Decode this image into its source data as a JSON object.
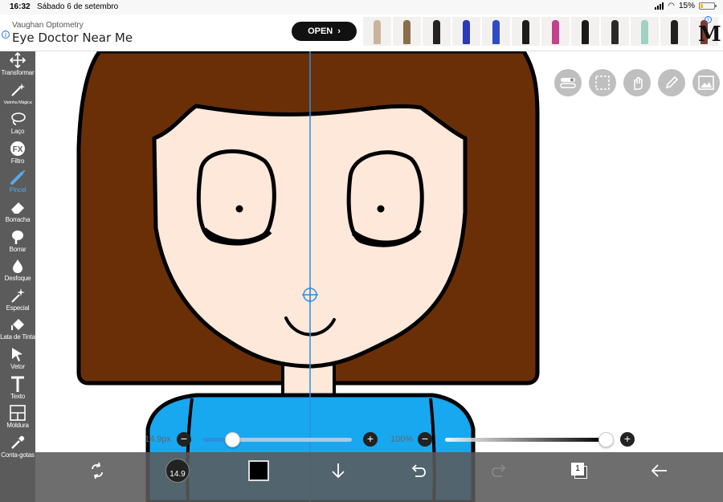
{
  "status_bar": {
    "time": "16:32",
    "date": "Sábado 6 de setembro",
    "battery": "15%",
    "battery_level": 0.15
  },
  "ad": {
    "brand": "Vaughan Optometry",
    "title": "Eye Doctor Near Me",
    "cta": "OPEN",
    "logo": "M",
    "info_icon": "info-icon",
    "product_colors": [
      "#c9b49a",
      "#8a6d4a",
      "#222222",
      "#2a3ab8",
      "#2e4bc6",
      "#1c1c1c",
      "#c2418f",
      "#1a1a1a",
      "#2a2a2a",
      "#9fd1c4",
      "#202020",
      "#7a3b2e"
    ]
  },
  "toolbar": {
    "tools": [
      {
        "id": "transform",
        "label": "Transformar",
        "icon": "move-icon"
      },
      {
        "id": "magic-wand",
        "label": "Varinha Mágica",
        "icon": "magic-wand-icon"
      },
      {
        "id": "lasso",
        "label": "Laço",
        "icon": "lasso-icon"
      },
      {
        "id": "filter",
        "label": "Filtro",
        "icon": "fx-icon"
      },
      {
        "id": "brush",
        "label": "Pincel",
        "icon": "brush-icon",
        "active": true
      },
      {
        "id": "eraser",
        "label": "Borracha",
        "icon": "eraser-icon"
      },
      {
        "id": "smudge",
        "label": "Borrar",
        "icon": "smudge-icon"
      },
      {
        "id": "blur",
        "label": "Desfoque",
        "icon": "drop-icon"
      },
      {
        "id": "special",
        "label": "Especial",
        "icon": "sparkle-icon"
      },
      {
        "id": "fill",
        "label": "Lata de Tinta",
        "icon": "paint-bucket-icon"
      },
      {
        "id": "vector",
        "label": "Vetor",
        "icon": "cursor-icon"
      },
      {
        "id": "text",
        "label": "Texto",
        "icon": "text-icon"
      },
      {
        "id": "frame",
        "label": "Moldura",
        "icon": "frame-icon"
      },
      {
        "id": "eyedropper",
        "label": "Conta-gotas",
        "icon": "eyedropper-icon"
      }
    ],
    "accent_color": "#58a8e8"
  },
  "overlay_buttons": [
    {
      "id": "toggle",
      "icon": "toggle-icon"
    },
    {
      "id": "selection",
      "icon": "selection-icon"
    },
    {
      "id": "hand",
      "icon": "hand-icon"
    },
    {
      "id": "pen",
      "icon": "pen-icon"
    },
    {
      "id": "image",
      "icon": "image-icon"
    }
  ],
  "sliders": {
    "size": {
      "label": "14.9px",
      "level": 0.2
    },
    "opacity": {
      "label": "100%",
      "level": 1.0
    }
  },
  "bottom_bar": {
    "brush_size": "14.9",
    "color": "#000000",
    "layer_count": "1",
    "icons": [
      "swap-icon",
      "brush-size-icon",
      "color-swatch-icon",
      "download-icon",
      "undo-icon",
      "redo-icon",
      "layers-icon",
      "back-icon"
    ]
  },
  "canvas": {
    "colors": {
      "hair": "#6a2f07",
      "skin": "#fde8da",
      "shirt": "#18a8f0",
      "outline": "#000000",
      "guide": "#2a8fe0"
    }
  }
}
